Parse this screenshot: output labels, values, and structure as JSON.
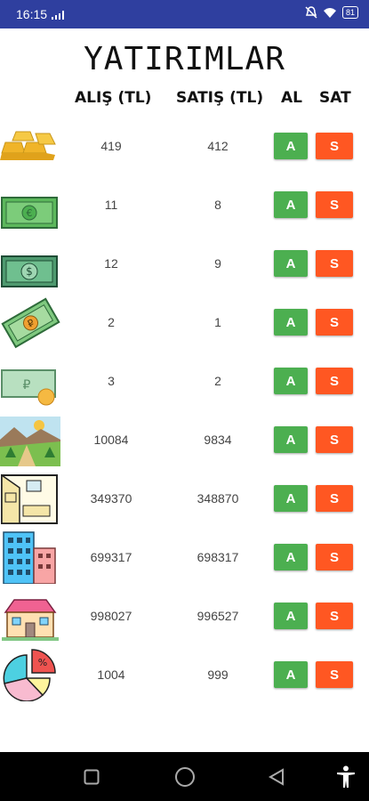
{
  "status": {
    "time": "16:15",
    "battery": "81"
  },
  "title": "YATIRIMLAR",
  "headers": {
    "buy": "ALIŞ (TL)",
    "sell": "SATIŞ (TL)",
    "al": "AL",
    "sat": "SAT"
  },
  "button_labels": {
    "buy": "A",
    "sell": "S"
  },
  "rows": [
    {
      "icon": "gold-bars-icon",
      "buy": "419",
      "sell": "412"
    },
    {
      "icon": "euro-banknote-icon",
      "buy": "11",
      "sell": "8"
    },
    {
      "icon": "dollar-banknote-icon",
      "buy": "12",
      "sell": "9"
    },
    {
      "icon": "ruble-banknote-icon",
      "buy": "2",
      "sell": "1"
    },
    {
      "icon": "lira-banknote-icon",
      "buy": "3",
      "sell": "2"
    },
    {
      "icon": "land-field-icon",
      "buy": "10084",
      "sell": "9834"
    },
    {
      "icon": "apartment-interior-icon",
      "buy": "349370",
      "sell": "348870"
    },
    {
      "icon": "office-building-icon",
      "buy": "699317",
      "sell": "698317"
    },
    {
      "icon": "house-icon",
      "buy": "998027",
      "sell": "996527"
    },
    {
      "icon": "pie-chart-icon",
      "buy": "1004",
      "sell": "999"
    }
  ],
  "colors": {
    "statusbar": "#2f3f9f",
    "buy_button": "#4caf50",
    "sell_button": "#ff5722",
    "navbar": "#000000"
  }
}
